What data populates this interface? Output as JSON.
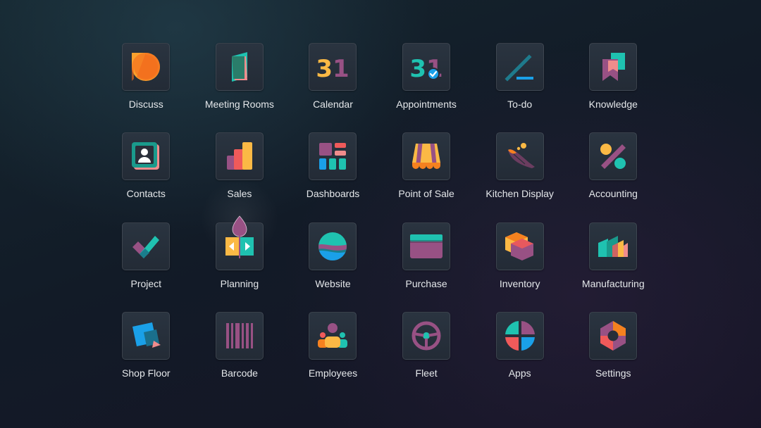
{
  "apps": [
    {
      "label": "Discuss",
      "icon": "discuss-icon"
    },
    {
      "label": "Meeting Rooms",
      "icon": "meeting-rooms-icon"
    },
    {
      "label": "Calendar",
      "icon": "calendar-icon",
      "icon_text": "31"
    },
    {
      "label": "Appointments",
      "icon": "appointments-icon",
      "icon_text": "31"
    },
    {
      "label": "To-do",
      "icon": "todo-icon"
    },
    {
      "label": "Knowledge",
      "icon": "knowledge-icon"
    },
    {
      "label": "Contacts",
      "icon": "contacts-icon"
    },
    {
      "label": "Sales",
      "icon": "sales-icon"
    },
    {
      "label": "Dashboards",
      "icon": "dashboards-icon"
    },
    {
      "label": "Point of Sale",
      "icon": "point-of-sale-icon"
    },
    {
      "label": "Kitchen Display",
      "icon": "kitchen-display-icon"
    },
    {
      "label": "Accounting",
      "icon": "accounting-icon"
    },
    {
      "label": "Project",
      "icon": "project-icon"
    },
    {
      "label": "Planning",
      "icon": "planning-icon"
    },
    {
      "label": "Website",
      "icon": "website-icon"
    },
    {
      "label": "Purchase",
      "icon": "purchase-icon"
    },
    {
      "label": "Inventory",
      "icon": "inventory-icon"
    },
    {
      "label": "Manufacturing",
      "icon": "manufacturing-icon"
    },
    {
      "label": "Shop Floor",
      "icon": "shop-floor-icon"
    },
    {
      "label": "Barcode",
      "icon": "barcode-icon"
    },
    {
      "label": "Employees",
      "icon": "employees-icon"
    },
    {
      "label": "Fleet",
      "icon": "fleet-icon"
    },
    {
      "label": "Apps",
      "icon": "apps-icon"
    },
    {
      "label": "Settings",
      "icon": "settings-icon"
    }
  ],
  "colors": {
    "orange": "#f5811f",
    "teal": "#1fc2b0",
    "purple": "#985184",
    "yellow": "#fbb945",
    "blue": "#1aa0e8",
    "red": "#f05a5a",
    "pink": "#f08c8c"
  }
}
